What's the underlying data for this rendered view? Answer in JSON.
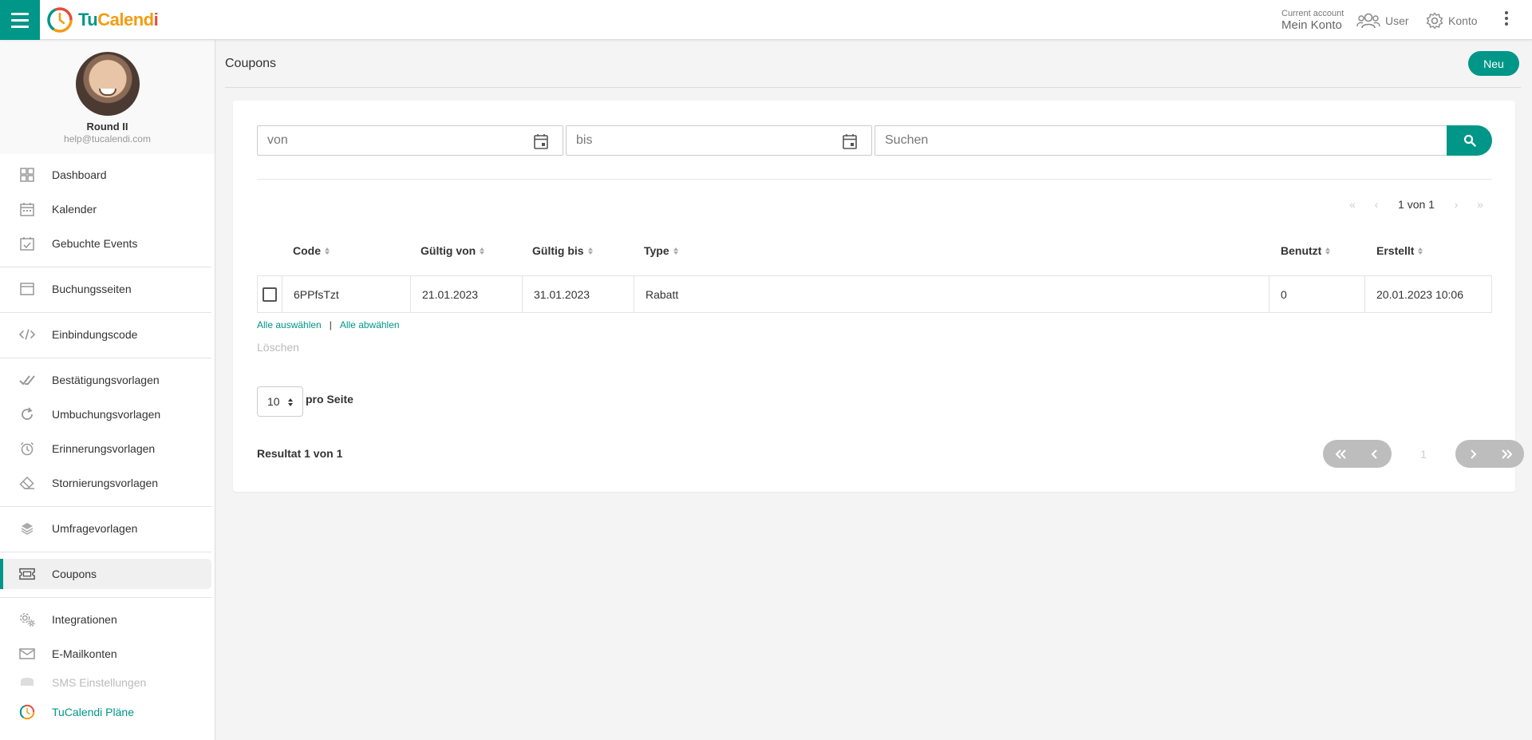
{
  "brand": {
    "name_part1": "Tu",
    "name_part2": "Calend",
    "name_part3": "i"
  },
  "header": {
    "account_small": "Current account",
    "account_name": "Mein Konto",
    "user_label": "User",
    "konto_label": "Konto"
  },
  "profile": {
    "name": "Round II",
    "email": "help@tucalendi.com"
  },
  "sidebar": {
    "items": [
      {
        "label": "Dashboard",
        "icon": "dashboard-grid-icon"
      },
      {
        "label": "Kalender",
        "icon": "calendar-icon"
      },
      {
        "label": "Gebuchte Events",
        "icon": "calendar-check-icon"
      },
      {
        "label": "Buchungsseiten",
        "icon": "browser-window-icon"
      },
      {
        "label": "Einbindungscode",
        "icon": "code-icon"
      },
      {
        "label": "Bestätigungsvorlagen",
        "icon": "double-check-icon"
      },
      {
        "label": "Umbuchungsvorlagen",
        "icon": "redo-icon"
      },
      {
        "label": "Erinnerungsvorlagen",
        "icon": "alarm-clock-icon"
      },
      {
        "label": "Stornierungsvorlagen",
        "icon": "eraser-icon"
      },
      {
        "label": "Umfragevorlagen",
        "icon": "layers-icon"
      },
      {
        "label": "Coupons",
        "icon": "ticket-icon"
      },
      {
        "label": "Integrationen",
        "icon": "gears-icon"
      },
      {
        "label": "E-Mailkonten",
        "icon": "envelope-icon"
      },
      {
        "label": "SMS Einstellungen",
        "icon": "sms-icon"
      },
      {
        "label": "TuCalendi Pläne",
        "icon": "tucalendi-logo-icon"
      }
    ]
  },
  "page": {
    "title": "Coupons",
    "new_button": "Neu"
  },
  "filters": {
    "from_placeholder": "von",
    "to_placeholder": "bis",
    "search_placeholder": "Suchen"
  },
  "pager_top": {
    "text": "1 von 1"
  },
  "table": {
    "columns": [
      "Code",
      "Gültig von",
      "Gültig bis",
      "Type",
      "Benutzt",
      "Erstellt"
    ],
    "rows": [
      {
        "code": "6PPfsTzt",
        "valid_from": "21.01.2023",
        "valid_to": "31.01.2023",
        "type": "Rabatt",
        "used": "0",
        "created": "20.01.2023 10:06"
      }
    ]
  },
  "selection": {
    "select_all": "Alle auswählen",
    "separator": "|",
    "deselect_all": "Alle abwählen",
    "delete": "Löschen"
  },
  "per_page": {
    "value": "10",
    "label": "pro Seite"
  },
  "result": {
    "text": "Resultat 1 von 1"
  },
  "pager_bottom": {
    "current_page": "1"
  },
  "colors": {
    "accent": "#009688",
    "logo_orange": "#f39c12"
  }
}
